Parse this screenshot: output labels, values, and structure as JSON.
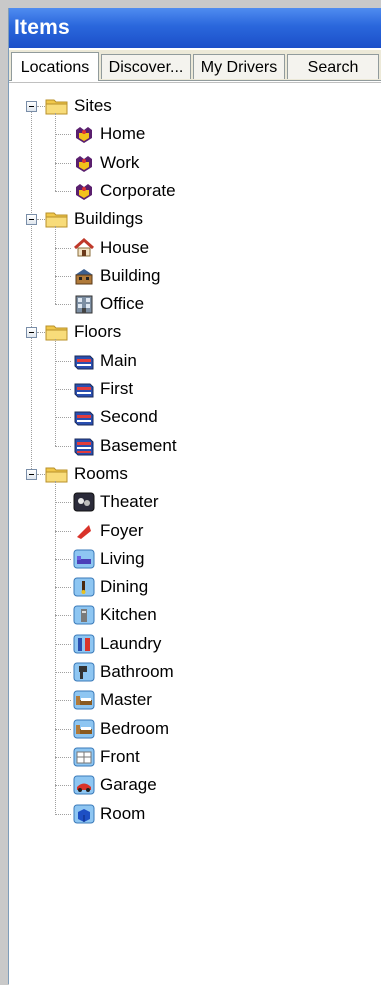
{
  "window": {
    "title": "Items"
  },
  "tabs": [
    {
      "label": "Locations",
      "active": true
    },
    {
      "label": "Discover...",
      "active": false
    },
    {
      "label": "My Drivers",
      "active": false
    },
    {
      "label": "Search",
      "active": false
    }
  ],
  "tree": [
    {
      "label": "Sites",
      "icon": "folder-icon",
      "expanded": true,
      "children": [
        {
          "label": "Home",
          "icon": "site-icon"
        },
        {
          "label": "Work",
          "icon": "site-icon"
        },
        {
          "label": "Corporate",
          "icon": "site-icon"
        }
      ]
    },
    {
      "label": "Buildings",
      "icon": "folder-icon",
      "expanded": true,
      "children": [
        {
          "label": "House",
          "icon": "house-icon"
        },
        {
          "label": "Building",
          "icon": "building-icon"
        },
        {
          "label": "Office",
          "icon": "office-icon"
        }
      ]
    },
    {
      "label": "Floors",
      "icon": "folder-icon",
      "expanded": true,
      "children": [
        {
          "label": "Main",
          "icon": "floor-icon"
        },
        {
          "label": "First",
          "icon": "floor-icon"
        },
        {
          "label": "Second",
          "icon": "floor-icon"
        },
        {
          "label": "Basement",
          "icon": "basement-icon"
        }
      ]
    },
    {
      "label": "Rooms",
      "icon": "folder-icon",
      "expanded": true,
      "children": [
        {
          "label": "Theater",
          "icon": "theater-icon"
        },
        {
          "label": "Foyer",
          "icon": "foyer-icon"
        },
        {
          "label": "Living",
          "icon": "living-icon"
        },
        {
          "label": "Dining",
          "icon": "dining-icon"
        },
        {
          "label": "Kitchen",
          "icon": "kitchen-icon"
        },
        {
          "label": "Laundry",
          "icon": "laundry-icon"
        },
        {
          "label": "Bathroom",
          "icon": "bathroom-icon"
        },
        {
          "label": "Master",
          "icon": "bed-icon"
        },
        {
          "label": "Bedroom",
          "icon": "bed-icon"
        },
        {
          "label": "Front",
          "icon": "front-icon"
        },
        {
          "label": "Garage",
          "icon": "garage-icon"
        },
        {
          "label": "Room",
          "icon": "room-icon"
        }
      ]
    }
  ],
  "colors": {
    "title_bar": "#2a67dc",
    "folder": "#f5d15c",
    "room_tile": "#8ec6f2"
  }
}
